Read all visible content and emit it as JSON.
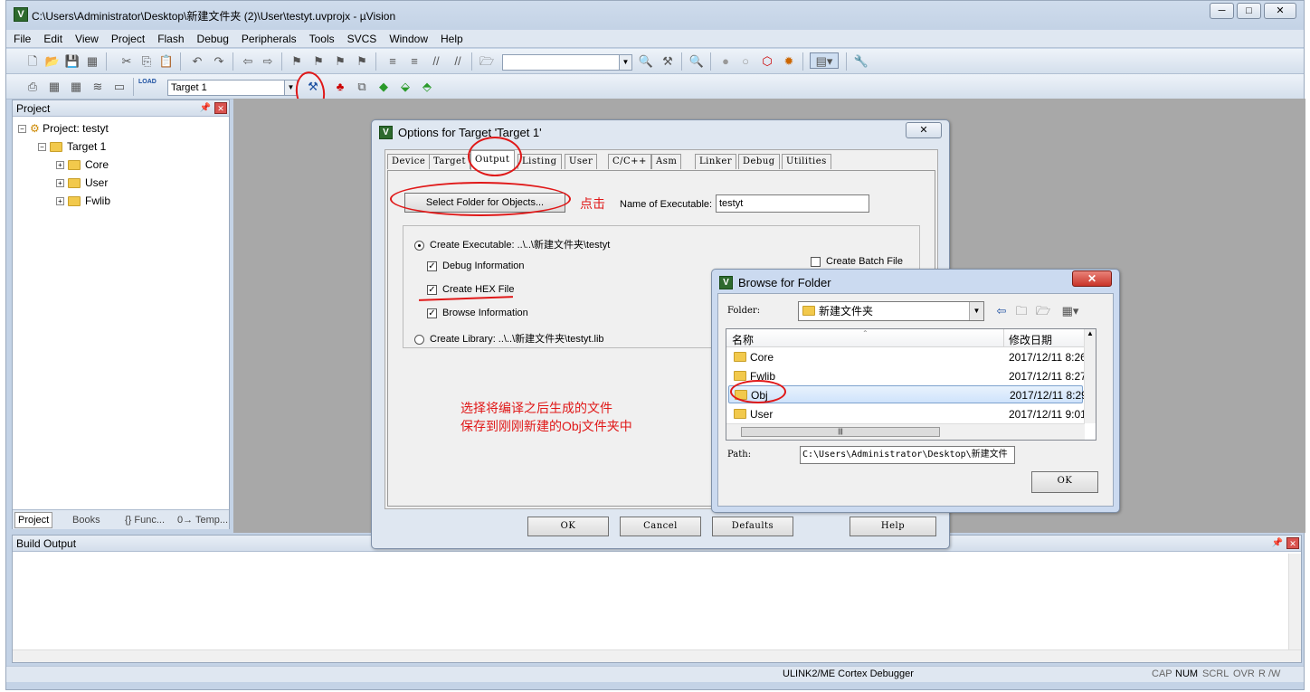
{
  "window": {
    "title": "C:\\Users\\Administrator\\Desktop\\新建文件夹 (2)\\User\\testyt.uvprojx - µVision",
    "minimize": "─",
    "maximize": "□",
    "close": "✕"
  },
  "menu": [
    "File",
    "Edit",
    "View",
    "Project",
    "Flash",
    "Debug",
    "Peripherals",
    "Tools",
    "SVCS",
    "Window",
    "Help"
  ],
  "toolbar2": {
    "target_combo": "Target 1",
    "load_label": "LOAD"
  },
  "project_panel": {
    "title": "Project",
    "root": "Project: testyt",
    "target": "Target 1",
    "groups": [
      "Core",
      "User",
      "Fwlib"
    ],
    "tabs": [
      "Project",
      "Books",
      "{} Func...",
      "0→ Temp..."
    ]
  },
  "options_dialog": {
    "title": "Options for Target 'Target 1'",
    "close": "✕",
    "tabs": [
      "Device",
      "Target",
      "Output",
      "Listing",
      "User",
      "C/C++",
      "Asm",
      "Linker",
      "Debug",
      "Utilities"
    ],
    "select_folder_btn": "Select Folder for Objects...",
    "annotation_click": "点击",
    "name_exe_label": "Name of Executable:",
    "name_exe_value": "testyt",
    "create_exe": "Create Executable:  ..\\..\\新建文件夹\\testyt",
    "debug_info": "Debug Information",
    "create_hex": "Create HEX File",
    "browse_info": "Browse Information",
    "create_lib": "Create Library:  ..\\..\\新建文件夹\\testyt.lib",
    "create_batch": "Create Batch File",
    "annotation_line1": "选择将编译之后生成的文件",
    "annotation_line2": "保存到刚刚新建的Obj文件夹中",
    "ok": "OK",
    "cancel": "Cancel",
    "defaults": "Defaults",
    "help": "Help"
  },
  "browse_dialog": {
    "title": "Browse for Folder",
    "close": "✕",
    "folder_label": "Folder:",
    "folder_value": "新建文件夹",
    "col_name": "名称",
    "col_date": "修改日期",
    "items": [
      {
        "name": "Core",
        "date": "2017/12/11 8:26"
      },
      {
        "name": "Fwlib",
        "date": "2017/12/11 8:27"
      },
      {
        "name": "Obj",
        "date": "2017/12/11 8:29"
      },
      {
        "name": "User",
        "date": "2017/12/11 9:01"
      }
    ],
    "path_label": "Path:",
    "path_value": "C:\\Users\\Administrator\\Desktop\\新建文件",
    "ok": "OK"
  },
  "build_output": {
    "title": "Build Output"
  },
  "status": {
    "debugger": "ULINK2/ME Cortex Debugger",
    "indicators": [
      "CAP",
      "NUM",
      "SCRL",
      "OVR",
      "R /W"
    ]
  },
  "colors": {
    "annotation": "#e01818",
    "accent": "#2e6a2e"
  }
}
